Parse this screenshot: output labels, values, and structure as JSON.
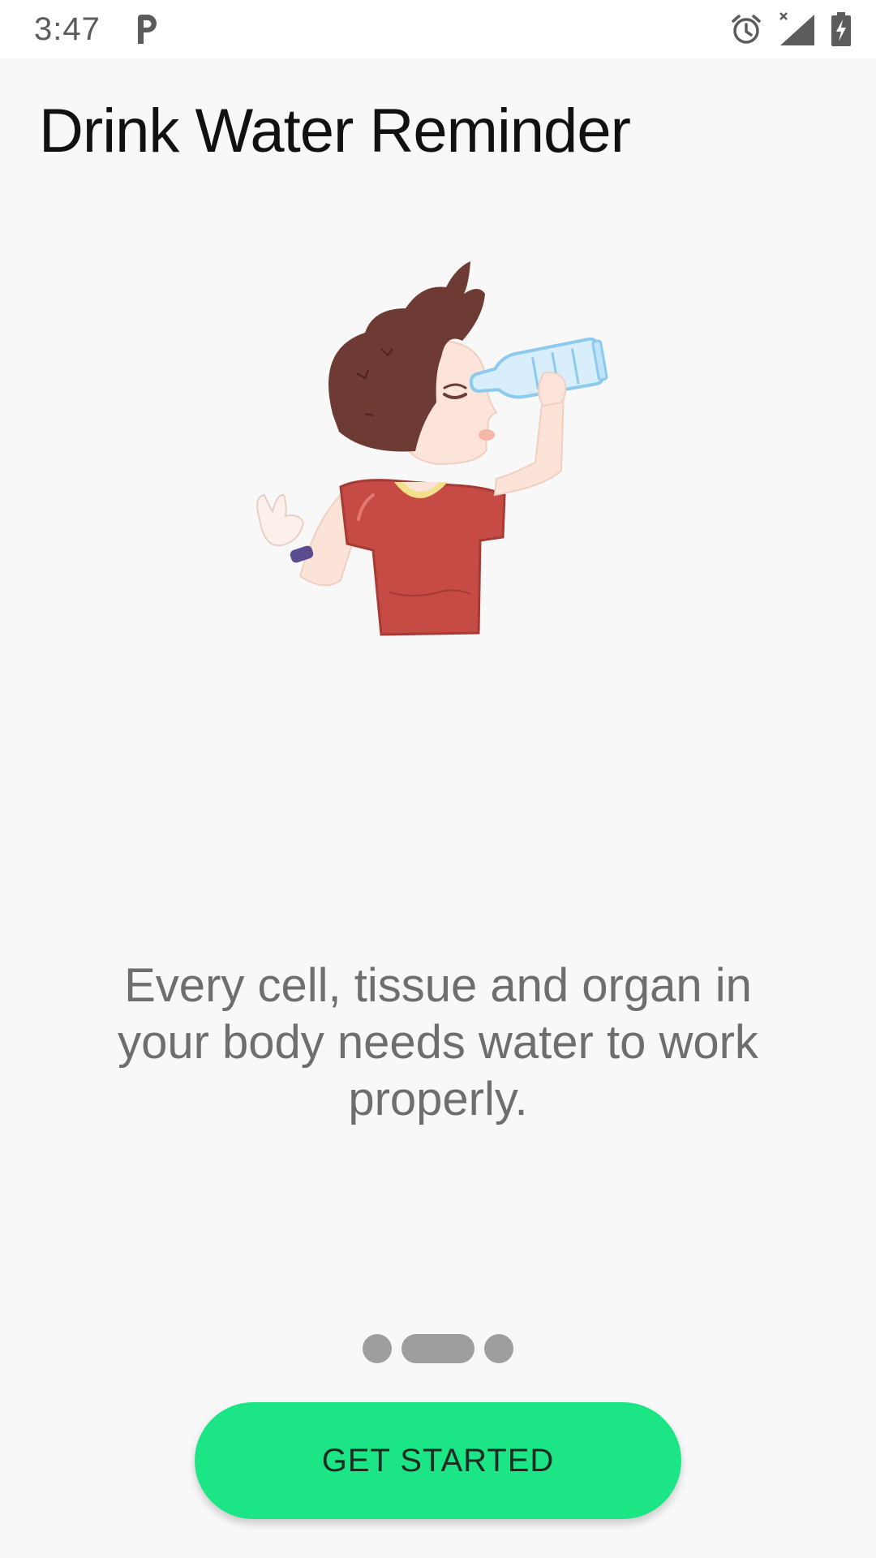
{
  "status_bar": {
    "time": "3:47",
    "icons": [
      "parking-app-icon",
      "alarm-icon",
      "no-signal-icon",
      "battery-charging-icon"
    ]
  },
  "app": {
    "title": "Drink Water Reminder"
  },
  "onboarding": {
    "illustration": "boy-drinking-water-illustration",
    "message": "Every cell, tissue and organ in your body needs water to work properly.",
    "pager": {
      "pages": 3,
      "current": 2
    },
    "cta_label": "GET STARTED"
  },
  "colors": {
    "background": "#f9f8f9",
    "accent": "#1be584",
    "dot": "#9e9e9e"
  }
}
